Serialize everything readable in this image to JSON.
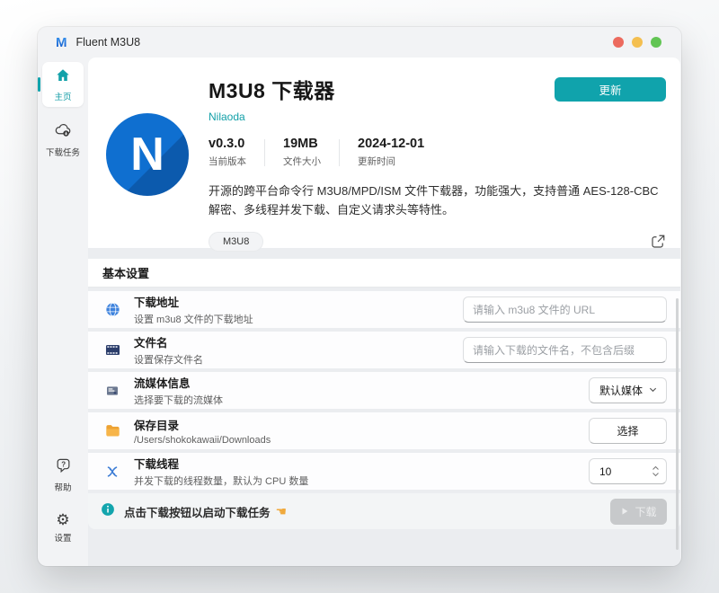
{
  "window": {
    "title": "Fluent M3U8",
    "app_icon_letter": "M"
  },
  "titlebar": {
    "traffic_lights": [
      {
        "name": "close",
        "color": "#ec6a5e"
      },
      {
        "name": "minimize",
        "color": "#f4bf50"
      },
      {
        "name": "zoom",
        "color": "#62c554"
      }
    ]
  },
  "sidebar": {
    "items": [
      {
        "label": "主页",
        "icon": "home-icon",
        "active": true
      },
      {
        "label": "下载任务",
        "icon": "cloud-download-icon",
        "active": false
      }
    ],
    "bottom_items": [
      {
        "label": "帮助",
        "icon": "help-bubble-icon"
      },
      {
        "label": "设置",
        "icon": "gear-icon"
      }
    ]
  },
  "header": {
    "logo_letter": "N",
    "app_title": "M3U8 下载器",
    "author": "Nilaoda",
    "update_button": "更新",
    "stats": [
      {
        "value": "v0.3.0",
        "label": "当前版本"
      },
      {
        "value": "19MB",
        "label": "文件大小"
      },
      {
        "value": "2024-12-01",
        "label": "更新时间"
      }
    ],
    "description": "开源的跨平台命令行 M3U8/MPD/ISM 文件下载器，功能强大，支持普通 AES-128-CBC 解密、多线程并发下载、自定义请求头等特性。",
    "tags": [
      "M3U8"
    ],
    "share_icon": "share-icon"
  },
  "settings": {
    "section_title": "基本设置",
    "rows": [
      {
        "icon": "globe-icon",
        "title": "下载地址",
        "subtitle": "设置 m3u8 文件的下载地址",
        "control": "input",
        "placeholder": "请输入 m3u8 文件的 URL"
      },
      {
        "icon": "film-icon",
        "title": "文件名",
        "subtitle": "设置保存文件名",
        "control": "input",
        "placeholder": "请输入下载的文件名，不包含后缀"
      },
      {
        "icon": "media-info-icon",
        "title": "流媒体信息",
        "subtitle": "选择要下载的流媒体",
        "control": "select",
        "value": "默认媒体"
      },
      {
        "icon": "folder-icon",
        "title": "保存目录",
        "subtitle": "/Users/shokokawaii/Downloads",
        "control": "button",
        "value": "选择"
      },
      {
        "icon": "threads-icon",
        "title": "下载线程",
        "subtitle": "并发下载的线程数量，默认为 CPU 数量",
        "control": "number-stepper",
        "value": "10"
      }
    ],
    "footer": {
      "info_icon": "info-icon",
      "hint": "点击下载按钮以启动下载任务",
      "hint_hand": "☚",
      "download_label": "下载",
      "download_enabled": false
    }
  },
  "colors": {
    "accent_teal": "#10a3ac",
    "logo_blue": "#0f6fd0",
    "globe_blue": "#3d82dd",
    "film_navy": "#2c3e6b",
    "folder_orange": "#f6ab3f",
    "threads_blue": "#3a7bd5",
    "window_bg": "#f2f3f5",
    "card_bg": "#ffffff",
    "disabled_button_bg": "#c7c9cb"
  }
}
